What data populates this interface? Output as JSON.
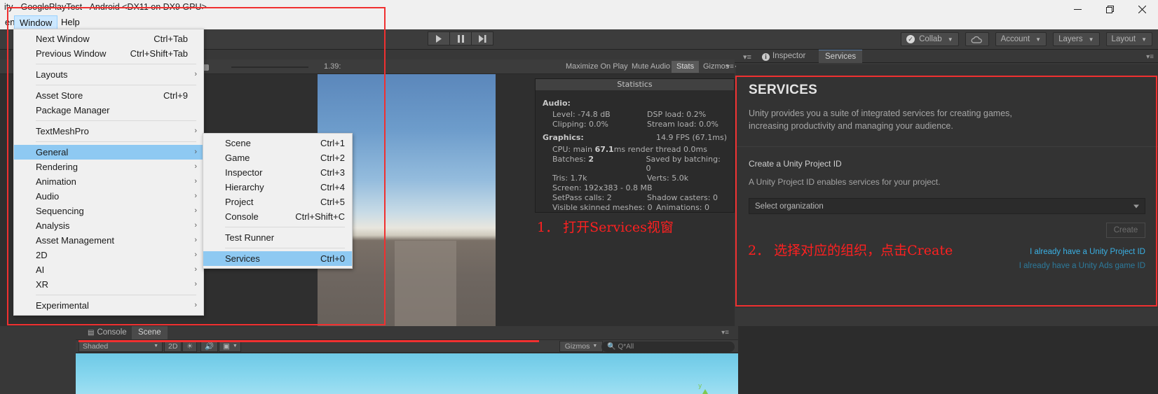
{
  "window": {
    "title": "ity - GooglePlayTest - Android <DX11 on DX9 GPU>",
    "minimize_icon": "minimize-icon",
    "maximize_icon": "maximize-icon",
    "close_icon": "close-icon"
  },
  "menubar": {
    "edit": "ent",
    "window": "Window",
    "help": "Help"
  },
  "window_menu": {
    "items": [
      {
        "label": "Next Window",
        "shortcut": "Ctrl+Tab",
        "arrow": "",
        "selected": false
      },
      {
        "label": "Previous Window",
        "shortcut": "Ctrl+Shift+Tab",
        "arrow": "",
        "selected": false
      },
      {
        "label": "Layouts",
        "shortcut": "",
        "arrow": "›",
        "selected": false
      },
      {
        "label": "Asset Store",
        "shortcut": "Ctrl+9",
        "arrow": "",
        "selected": false
      },
      {
        "label": "Package Manager",
        "shortcut": "",
        "arrow": "",
        "selected": false
      },
      {
        "label": "TextMeshPro",
        "shortcut": "",
        "arrow": "›",
        "selected": false
      },
      {
        "label": "General",
        "shortcut": "",
        "arrow": "›",
        "selected": true
      },
      {
        "label": "Rendering",
        "shortcut": "",
        "arrow": "›",
        "selected": false
      },
      {
        "label": "Animation",
        "shortcut": "",
        "arrow": "›",
        "selected": false
      },
      {
        "label": "Audio",
        "shortcut": "",
        "arrow": "›",
        "selected": false
      },
      {
        "label": "Sequencing",
        "shortcut": "",
        "arrow": "›",
        "selected": false
      },
      {
        "label": "Analysis",
        "shortcut": "",
        "arrow": "›",
        "selected": false
      },
      {
        "label": "Asset Management",
        "shortcut": "",
        "arrow": "›",
        "selected": false
      },
      {
        "label": "2D",
        "shortcut": "",
        "arrow": "›",
        "selected": false
      },
      {
        "label": "AI",
        "shortcut": "",
        "arrow": "›",
        "selected": false
      },
      {
        "label": "XR",
        "shortcut": "",
        "arrow": "›",
        "selected": false
      },
      {
        "label": "Experimental",
        "shortcut": "",
        "arrow": "›",
        "selected": false
      }
    ]
  },
  "general_submenu": {
    "items": [
      {
        "label": "Scene",
        "shortcut": "Ctrl+1",
        "selected": false
      },
      {
        "label": "Game",
        "shortcut": "Ctrl+2",
        "selected": false
      },
      {
        "label": "Inspector",
        "shortcut": "Ctrl+3",
        "selected": false
      },
      {
        "label": "Hierarchy",
        "shortcut": "Ctrl+4",
        "selected": false
      },
      {
        "label": "Project",
        "shortcut": "Ctrl+5",
        "selected": false
      },
      {
        "label": "Console",
        "shortcut": "Ctrl+Shift+C",
        "selected": false
      },
      {
        "label": "Test Runner",
        "shortcut": "",
        "selected": false
      },
      {
        "label": "Services",
        "shortcut": "Ctrl+0",
        "selected": true
      }
    ]
  },
  "toolbar": {
    "play_icon": "play-icon",
    "pause_icon": "pause-icon",
    "step_icon": "step-forward-icon",
    "collab": "Collab",
    "cloud_icon": "cloud-icon",
    "account": "Account",
    "layers": "Layers",
    "layout": "Layout"
  },
  "game_toolbar": {
    "maximize_on_play": "Maximize On Play",
    "mute_audio": "Mute Audio",
    "stats": "Stats",
    "gizmos": "Gizmos",
    "aspect_value": "1.39:",
    "menu_icon": "panel-menu-icon"
  },
  "statistics": {
    "title": "Statistics",
    "audio_header": "Audio:",
    "level": "Level: -74.8 dB",
    "dsp_load": "DSP load: 0.2%",
    "clipping": "Clipping: 0.0%",
    "stream_load": "Stream load: 0.0%",
    "graphics_header": "Graphics:",
    "fps": "14.9 FPS (67.1ms)",
    "cpu_prefix": "CPU: main ",
    "cpu_value": "67.1",
    "cpu_suffix": "ms   render thread 0.0ms",
    "batches_prefix": "Batches: ",
    "batches_value": "2",
    "saved_by_batching": "Saved by batching: 0",
    "tris": "Tris: 1.7k",
    "verts": "Verts: 5.0k",
    "screen": "Screen: 192x383 - 0.8 MB",
    "setpass": "SetPass calls: 2",
    "shadow_casters": "Shadow casters: 0",
    "visible_skinned": "Visible skinned meshes: 0",
    "animations": "Animations: 0"
  },
  "inspector_tabs": {
    "menu_icon": "panel-menu-icon",
    "inspector": "Inspector",
    "services": "Services",
    "info_icon": "info-icon",
    "lock_icon": "panel-options-icon"
  },
  "services": {
    "title": "SERVICES",
    "description": "Unity provides you a suite of integrated services for creating games, increasing productivity and managing your audience.",
    "create_label": "Create a Unity Project ID",
    "create_sub": "A Unity Project ID enables services for your project.",
    "org_placeholder": "Select organization",
    "create_button": "Create",
    "link_project_id": "I already have a Unity Project ID",
    "link_ads_id": "I already have a Unity Ads game ID"
  },
  "bottom_panel": {
    "console_tab": "Console",
    "console_icon": "console-icon",
    "scene_tab": "Scene",
    "shading_mode": "Shaded",
    "two_d": "2D",
    "light_icon": "lighting-icon",
    "audio_icon": "audio-icon",
    "fx_icon": "effects-icon",
    "gizmos": "Gizmos",
    "search_placeholder": "Q*All",
    "search_icon": "search-icon",
    "axis_label": "y",
    "menu_icon": "panel-menu-icon"
  },
  "annotations": {
    "step1": "1． 打开Services视窗",
    "step2": "2． 选择对应的组织，点击Create",
    "highlight_color": "#f03030"
  }
}
